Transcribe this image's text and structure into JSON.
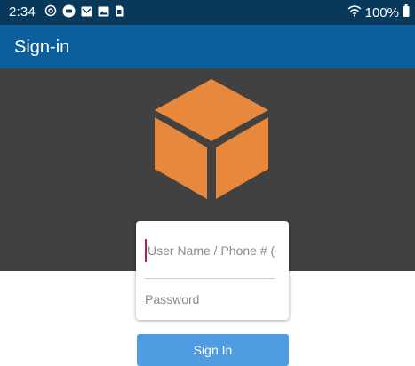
{
  "status_bar": {
    "time": "2:34",
    "battery": "100%",
    "icons": [
      "at-icon",
      "messenger-icon",
      "email-icon",
      "image-icon",
      "sim-icon",
      "wifi-icon",
      "battery-icon"
    ]
  },
  "app_bar": {
    "title": "Sign-in"
  },
  "hero": {
    "logo_icon": "cube-icon",
    "logo_color": "#e8883c",
    "background": "#414141"
  },
  "login_form": {
    "username_placeholder": "User Name / Phone # (+",
    "password_placeholder": "Password"
  },
  "signin_button": {
    "label": "Sign In",
    "color": "#4f9ce3"
  },
  "colors": {
    "status_bar": "#08385a",
    "app_bar": "#0a5f9c"
  }
}
